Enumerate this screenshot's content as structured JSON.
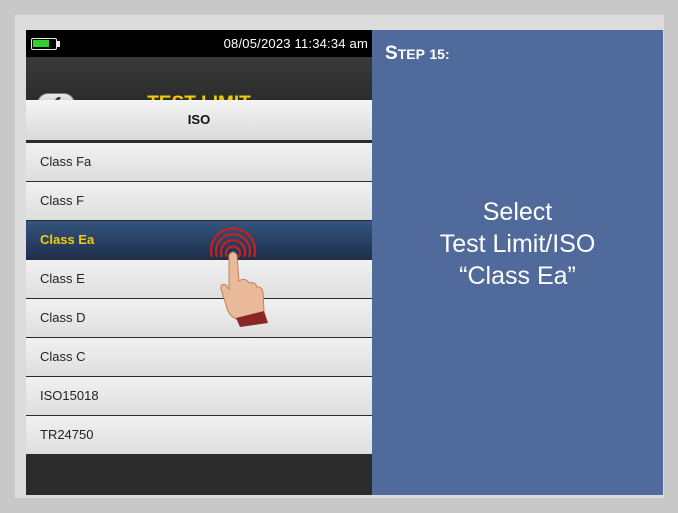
{
  "device": {
    "datetime": "08/05/2023 11:34:34 am",
    "battery_color": "#2fd12a",
    "title": "TEST LIMIT",
    "back_icon": "chevron-left-icon",
    "list_header": "ISO",
    "items": [
      {
        "label": "Class Fa",
        "selected": false
      },
      {
        "label": "Class F",
        "selected": false
      },
      {
        "label": "Class Ea",
        "selected": true
      },
      {
        "label": "Class E",
        "selected": false
      },
      {
        "label": "Class D",
        "selected": false
      },
      {
        "label": "Class C",
        "selected": false
      },
      {
        "label": "ISO15018",
        "selected": false
      },
      {
        "label": "TR24750",
        "selected": false
      }
    ],
    "accent_color": "#f2cb05"
  },
  "panel": {
    "step_first": "S",
    "step_rest": "TEP",
    "step_number": "15:",
    "instruction_line1": "Select",
    "instruction_line2": "Test Limit/ISO",
    "instruction_line3": "“Class Ea”",
    "background": "#506a9b"
  }
}
